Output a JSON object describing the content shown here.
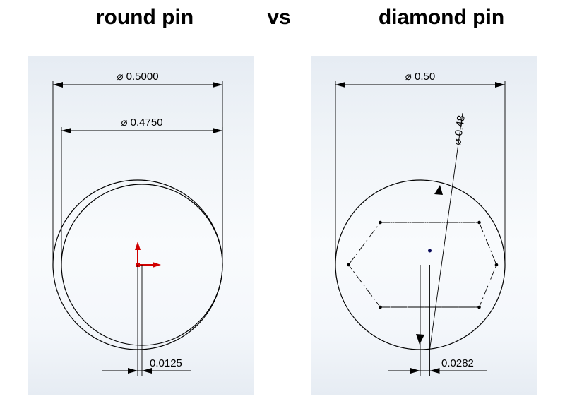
{
  "titles": {
    "left": "round pin",
    "mid": "vs",
    "right": "diamond pin"
  },
  "round_pin": {
    "dim_outer": "⌀ 0.5000",
    "dim_inner": "⌀ 0.4750",
    "dim_offset": "0.0125"
  },
  "diamond_pin": {
    "dim_outer": "⌀ 0.50",
    "dim_inner": "⌀ 0.48",
    "dim_offset": "0.0282"
  },
  "chart_data": {
    "type": "diagram",
    "unit": "inch",
    "round_pin": {
      "hole_diameter": 0.5,
      "pin_diameter": 0.475,
      "lateral_offset": 0.0125
    },
    "diamond_pin": {
      "hole_diameter": 0.5,
      "across_flats_diameter_note": "⌀ 0.48",
      "lateral_offset": 0.0282
    }
  },
  "icons": {
    "origin_point": "blue-origin-point"
  }
}
